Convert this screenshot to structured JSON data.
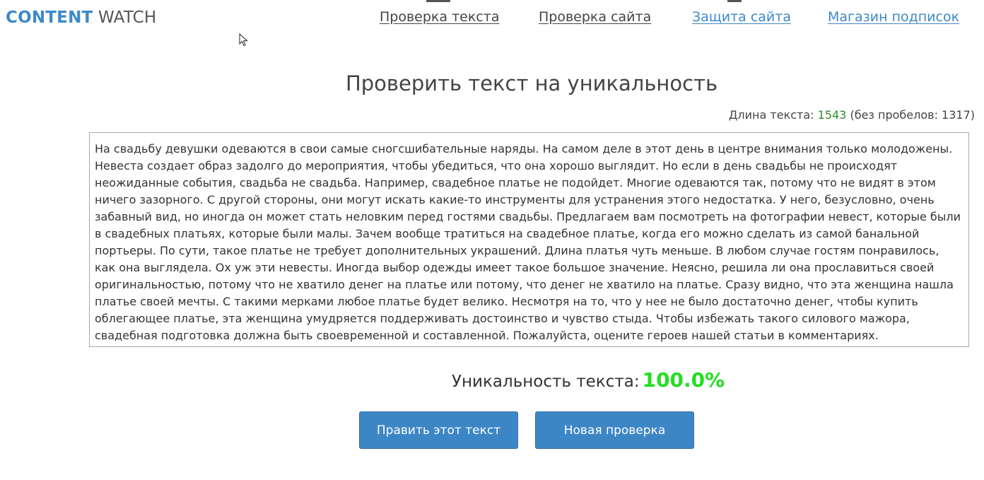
{
  "logo": {
    "part1": "CONTENT",
    "part2": "WATCH"
  },
  "nav": {
    "check_text": "Проверка текста",
    "check_site": "Проверка сайта",
    "protect_site": "Защита сайта",
    "subscriptions": "Магазин подписок"
  },
  "main": {
    "title": "Проверить текст на уникальность",
    "length_label": "Длина текста:",
    "length_value": "1543",
    "length_no_spaces": "(без пробелов: 1317)",
    "text": "На свадьбу девушки одеваются в свои самые сногсшибательные наряды. На самом деле в этот день в центре внимания только молодожены. Невеста создает образ задолго до мероприятия, чтобы убедиться, что она хорошо выглядит. Но если в день свадьбы не происходят неожиданные события, свадьба не свадьба. Например, свадебное платье не подойдет. Многие одеваются так, потому что не видят в этом ничего зазорного. С другой стороны, они могут искать какие-то инструменты для устранения этого недостатка. У него, безусловно, очень забавный вид, но иногда он может стать неловким перед гостями свадьбы. Предлагаем вам посмотреть на фотографии невест, которые были в свадебных платьях, которые были малы. Зачем вообще тратиться на свадебное платье, когда его можно сделать из самой банальной портьеры. По сути, такое платье не требует дополнительных украшений. Длина платья чуть меньше. В любом случае гостям понравилось, как она выглядела. Ох уж эти невесты. Иногда выбор одежды имеет такое большое значение. Неясно, решила ли она прославиться своей оригинальностью, потому что не хватило денег на платье или потому, что денег не хватило на платье. Сразу видно, что эта женщина нашла платье своей мечты. С такими мерками любое платье будет велико. Несмотря на то, что у нее не было достаточно денег, чтобы купить облегающее платье, эта женщина умудряется поддерживать достоинство и чувство стыда. Чтобы избежать такого силового мажора, свадебная подготовка должна быть своевременной и составленной. Пожалуйста, оцените героев нашей статьи в комментариях.",
    "uniqueness_label": "Уникальность текста:",
    "uniqueness_value": "100.0%"
  },
  "buttons": {
    "edit": "Править этот текст",
    "new_check": "Новая проверка"
  },
  "colors": {
    "accent": "#3d89c9",
    "button_bg": "#3d86c6",
    "uniqueness_green": "#1fe01f",
    "length_green": "#2e8b2e"
  }
}
